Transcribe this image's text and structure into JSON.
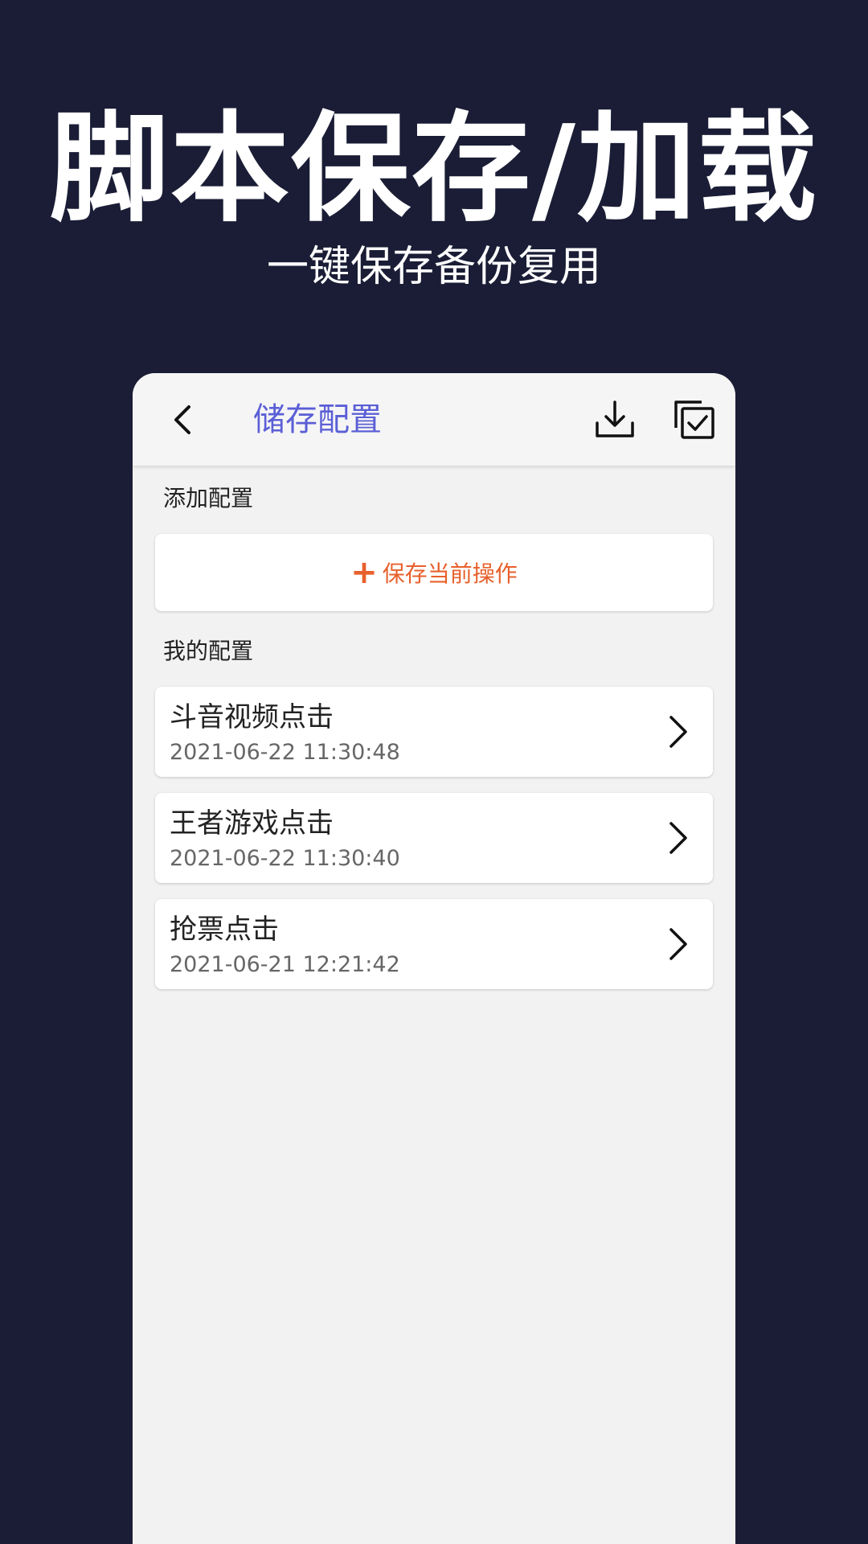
{
  "promo": {
    "title": "脚本保存/加载",
    "subtitle": "一键保存备份复用"
  },
  "appbar": {
    "back_icon": "chevron-left-icon",
    "title": "储存配置",
    "title_color": "#5b5fd6",
    "download_icon": "download-icon",
    "multi_select_icon": "multi-check-icon"
  },
  "add_section": {
    "label": "添加配置",
    "button_icon": "+",
    "button_label": "保存当前操作",
    "accent_color": "#e8602c"
  },
  "my_section": {
    "label": "我的配置",
    "items": [
      {
        "name": "斗音视频点击",
        "time": "2021-06-22 11:30:48"
      },
      {
        "name": "王者游戏点击",
        "time": "2021-06-22 11:30:40"
      },
      {
        "name": "抢票点击",
        "time": "2021-06-21 12:21:42"
      }
    ]
  },
  "colors": {
    "background": "#1a1d35",
    "panel": "#f2f2f2"
  }
}
